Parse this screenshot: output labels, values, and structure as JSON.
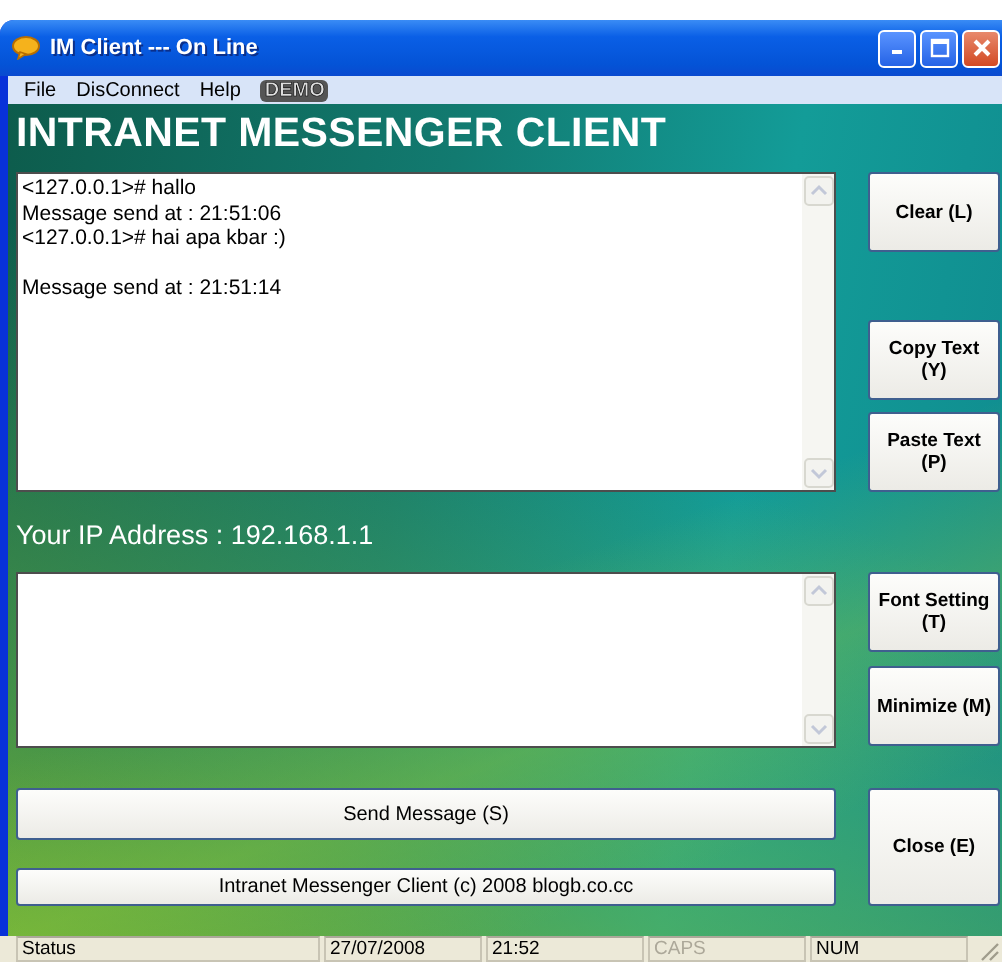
{
  "window": {
    "title": "IM Client --- On Line"
  },
  "menu": [
    {
      "label": "File"
    },
    {
      "label": "DisConnect"
    },
    {
      "label": "Help"
    }
  ],
  "demo_badge": "DEMO",
  "banner": "INTRANET MESSENGER CLIENT",
  "chat_log": [
    {
      "text": "<127.0.0.1># hallo",
      "blank_before": false
    },
    {
      "text": "Message send at : 21:51:06",
      "blank_before": false
    },
    {
      "text": "<127.0.0.1># hai apa kbar :)",
      "blank_before": false
    },
    {
      "text": "Message send at : 21:51:14",
      "blank_before": true
    }
  ],
  "ip_label": "Your IP Address : 192.168.1.1",
  "send_button": "Send Message (S)",
  "credit_button": "Intranet Messenger Client (c) 2008 blogb.co.cc",
  "side_buttons": [
    {
      "lines": [
        "Clear (L)"
      ]
    },
    {
      "lines": [
        "Copy Text",
        "(Y)"
      ]
    },
    {
      "lines": [
        "Paste Text",
        "(P)"
      ]
    },
    {
      "lines": [
        "Font Setting",
        "(T)"
      ]
    },
    {
      "lines": [
        "Minimize (M)"
      ]
    },
    {
      "lines": [
        "Close (E)"
      ]
    }
  ],
  "status_bar": [
    {
      "text": "Status",
      "active": true
    },
    {
      "text": "27/07/2008",
      "active": true
    },
    {
      "text": "21:52",
      "active": true
    },
    {
      "text": "CAPS",
      "active": false
    },
    {
      "text": "NUM",
      "active": true
    }
  ]
}
